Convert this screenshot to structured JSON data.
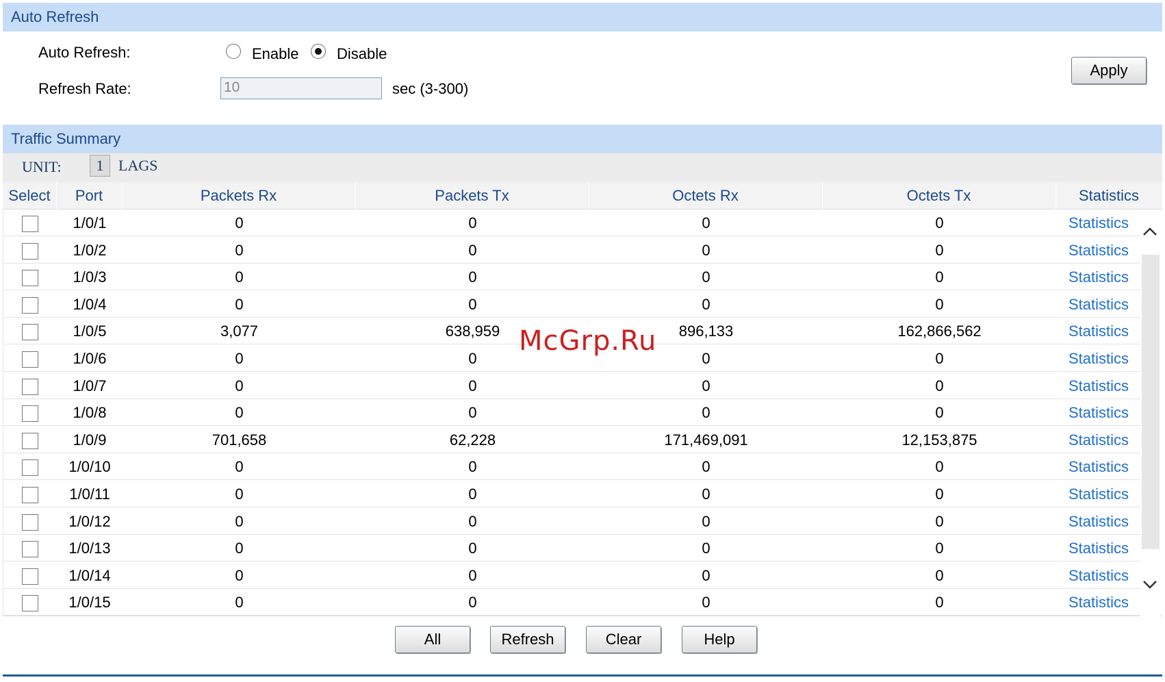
{
  "auto_refresh": {
    "header": "Auto Refresh",
    "label": "Auto Refresh:",
    "enable_label": "Enable",
    "disable_label": "Disable",
    "selected": "Disable",
    "rate_label": "Refresh Rate:",
    "rate_value": "10",
    "rate_unit": "sec (3-300)",
    "apply_label": "Apply"
  },
  "traffic_summary": {
    "header": "Traffic Summary",
    "unit_label": "UNIT:",
    "unit_value": "1",
    "lags_label": "LAGS",
    "columns": [
      "Select",
      "Port",
      "Packets Rx",
      "Packets Tx",
      "Octets Rx",
      "Octets Tx",
      "Statistics"
    ],
    "rows": [
      {
        "port": "1/0/1",
        "packets_rx": "0",
        "packets_tx": "0",
        "octets_rx": "0",
        "octets_tx": "0",
        "statistics": "Statistics"
      },
      {
        "port": "1/0/2",
        "packets_rx": "0",
        "packets_tx": "0",
        "octets_rx": "0",
        "octets_tx": "0",
        "statistics": "Statistics"
      },
      {
        "port": "1/0/3",
        "packets_rx": "0",
        "packets_tx": "0",
        "octets_rx": "0",
        "octets_tx": "0",
        "statistics": "Statistics"
      },
      {
        "port": "1/0/4",
        "packets_rx": "0",
        "packets_tx": "0",
        "octets_rx": "0",
        "octets_tx": "0",
        "statistics": "Statistics"
      },
      {
        "port": "1/0/5",
        "packets_rx": "3,077",
        "packets_tx": "638,959",
        "octets_rx": "896,133",
        "octets_tx": "162,866,562",
        "statistics": "Statistics"
      },
      {
        "port": "1/0/6",
        "packets_rx": "0",
        "packets_tx": "0",
        "octets_rx": "0",
        "octets_tx": "0",
        "statistics": "Statistics"
      },
      {
        "port": "1/0/7",
        "packets_rx": "0",
        "packets_tx": "0",
        "octets_rx": "0",
        "octets_tx": "0",
        "statistics": "Statistics"
      },
      {
        "port": "1/0/8",
        "packets_rx": "0",
        "packets_tx": "0",
        "octets_rx": "0",
        "octets_tx": "0",
        "statistics": "Statistics"
      },
      {
        "port": "1/0/9",
        "packets_rx": "701,658",
        "packets_tx": "62,228",
        "octets_rx": "171,469,091",
        "octets_tx": "12,153,875",
        "statistics": "Statistics"
      },
      {
        "port": "1/0/10",
        "packets_rx": "0",
        "packets_tx": "0",
        "octets_rx": "0",
        "octets_tx": "0",
        "statistics": "Statistics"
      },
      {
        "port": "1/0/11",
        "packets_rx": "0",
        "packets_tx": "0",
        "octets_rx": "0",
        "octets_tx": "0",
        "statistics": "Statistics"
      },
      {
        "port": "1/0/12",
        "packets_rx": "0",
        "packets_tx": "0",
        "octets_rx": "0",
        "octets_tx": "0",
        "statistics": "Statistics"
      },
      {
        "port": "1/0/13",
        "packets_rx": "0",
        "packets_tx": "0",
        "octets_rx": "0",
        "octets_tx": "0",
        "statistics": "Statistics"
      },
      {
        "port": "1/0/14",
        "packets_rx": "0",
        "packets_tx": "0",
        "octets_rx": "0",
        "octets_tx": "0",
        "statistics": "Statistics"
      },
      {
        "port": "1/0/15",
        "packets_rx": "0",
        "packets_tx": "0",
        "octets_rx": "0",
        "octets_tx": "0",
        "statistics": "Statistics"
      }
    ]
  },
  "actions": {
    "all_label": "All",
    "refresh_label": "Refresh",
    "clear_label": "Clear",
    "help_label": "Help"
  },
  "watermark": "McGrp.Ru",
  "icons": {
    "scroll_up": "chevron-up-icon",
    "scroll_down": "chevron-down-icon"
  },
  "colors": {
    "header_bg": "#c7dcf7",
    "header_text": "#1a4a8a",
    "link": "#1f6fd1",
    "watermark": "#cc1f1f"
  }
}
